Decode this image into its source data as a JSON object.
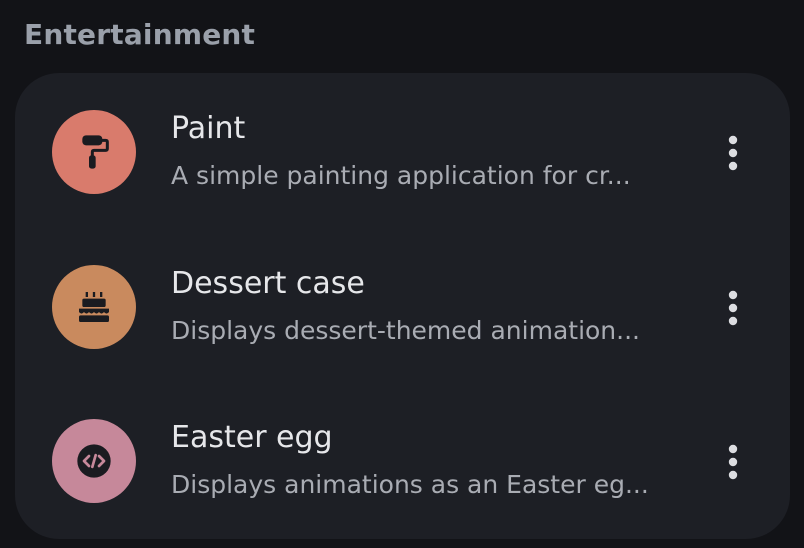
{
  "section": {
    "title": "Entertainment"
  },
  "apps": [
    {
      "name": "Paint",
      "description": "A simple painting application for cr...",
      "icon": "paint-roller-icon",
      "color": "#d97b6c"
    },
    {
      "name": "Dessert case",
      "description": "Displays dessert-themed animation...",
      "icon": "cake-icon",
      "color": "#c98a5e"
    },
    {
      "name": "Easter egg",
      "description": "Displays animations as an Easter eg...",
      "icon": "code-icon",
      "color": "#c6889a"
    }
  ],
  "colors": {
    "background": "#121317",
    "card": "#1d1f25",
    "title_text": "#e6e7ea",
    "subtitle_text": "#a9acb3",
    "section_text": "#9aa0aa",
    "icon_dark": "#1a1b20"
  }
}
